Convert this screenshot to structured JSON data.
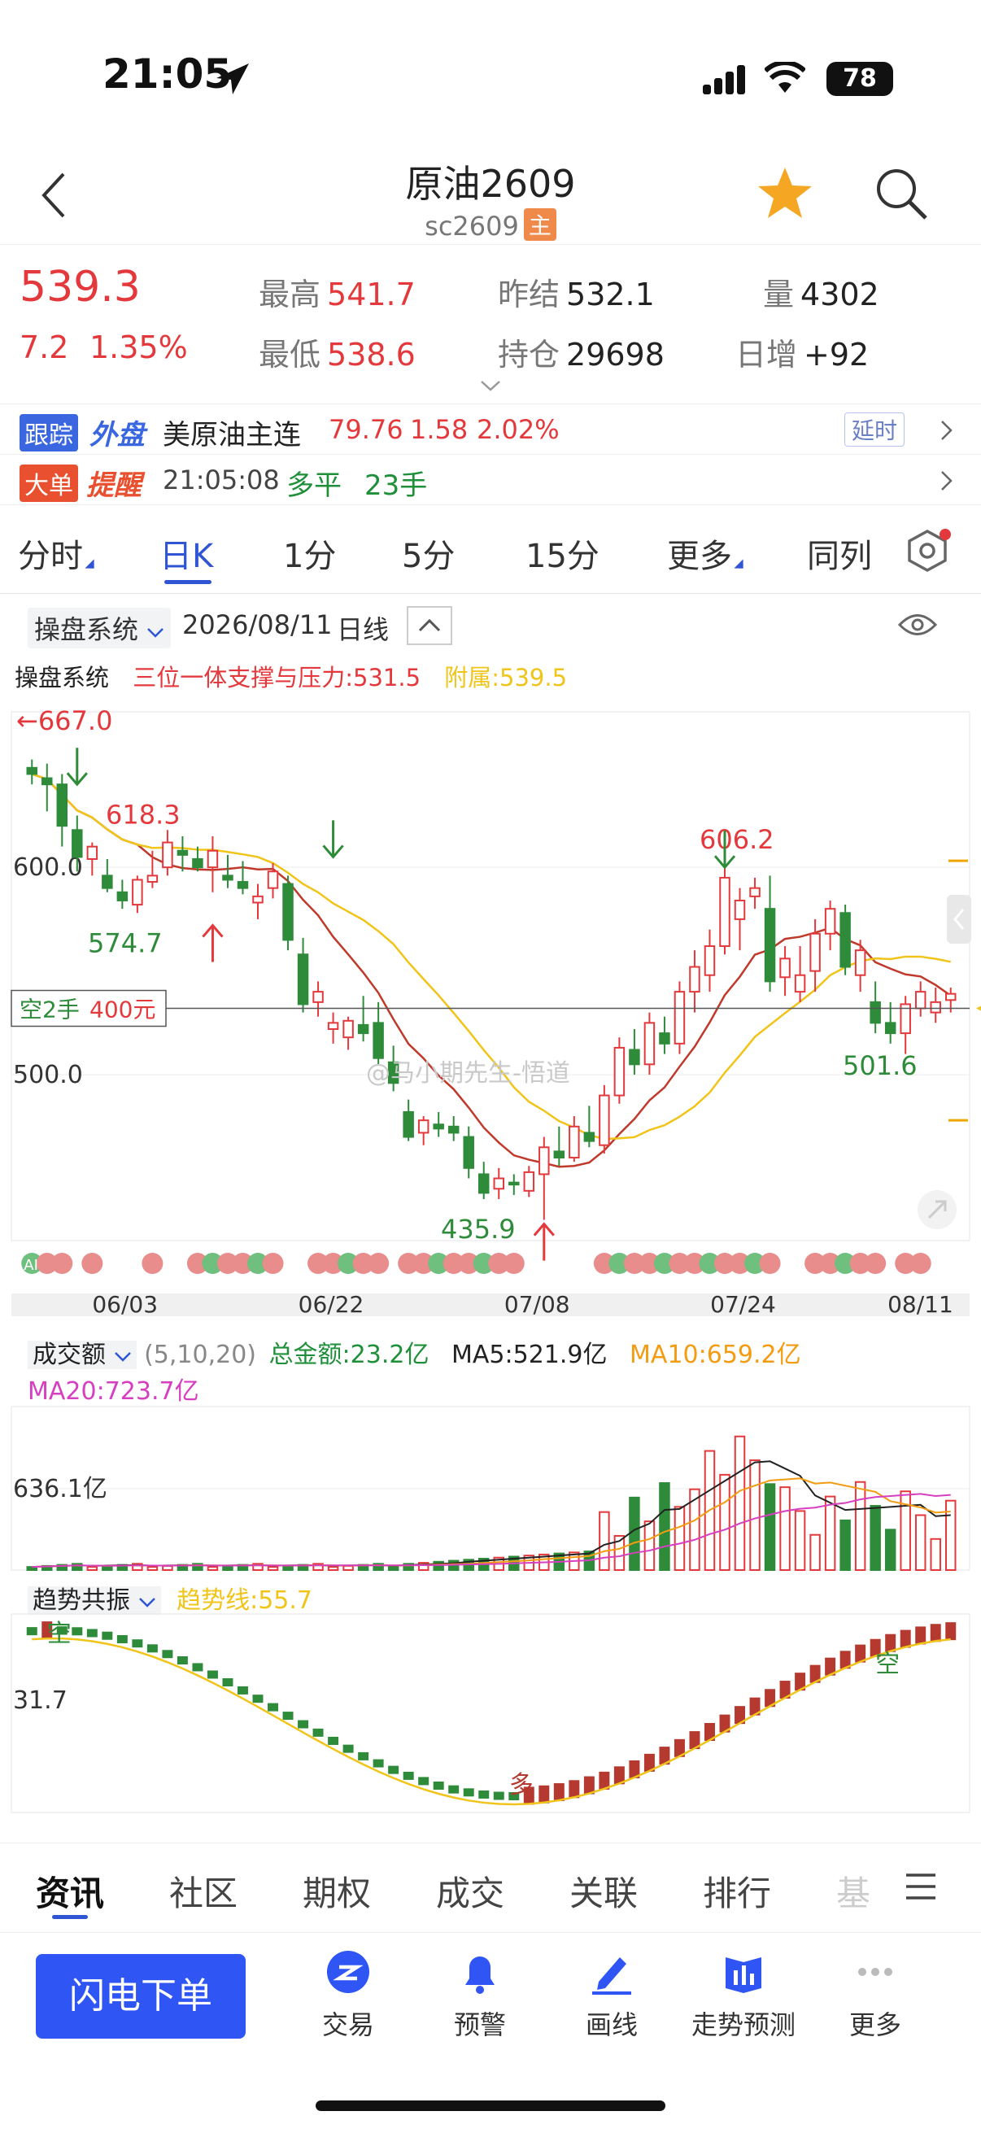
{
  "status": {
    "time": "21:05",
    "battery": "78"
  },
  "header": {
    "title": "原油2609",
    "code": "sc2609",
    "main_badge": "主"
  },
  "quote": {
    "price": "539.3",
    "change": "7.2",
    "change_pct": "1.35%",
    "high_label": "最高",
    "high": "541.7",
    "low_label": "最低",
    "low": "538.6",
    "prev_settle_label": "昨结",
    "prev_settle": "532.1",
    "open_int_label": "持仓",
    "open_int": "29698",
    "volume_label": "量",
    "volume": "4302",
    "daily_inc_label": "日增",
    "daily_inc": "+92"
  },
  "ticker": {
    "badge_a": "跟踪",
    "badge_b": "外盘",
    "name": "美原油主连",
    "price": "79.76",
    "change": "1.58",
    "pct": "2.02%",
    "delay": "延时"
  },
  "bigorder": {
    "badge_a": "大单",
    "badge_b": "提醒",
    "time": "21:05:08",
    "action": "多平",
    "qty": "23手"
  },
  "tabs": [
    {
      "label": "分时",
      "tri": true
    },
    {
      "label": "日K",
      "active": true
    },
    {
      "label": "1分"
    },
    {
      "label": "5分"
    },
    {
      "label": "15分"
    },
    {
      "label": "更多",
      "tri": true
    },
    {
      "label": "同列"
    }
  ],
  "toolbar": {
    "system": "操盘系统",
    "date": "2026/08/11",
    "period": "日线"
  },
  "indicator": {
    "name": "操盘系统",
    "support": "三位一体支撑与压力:531.5",
    "attach": "附属:539.5"
  },
  "chart_data": [
    {
      "type": "candlestick",
      "title": "日K",
      "x_ticks": [
        "06/03",
        "06/22",
        "07/08",
        "07/24",
        "08/11"
      ],
      "y_ticks": [
        "600.0",
        "500.0"
      ],
      "ylim": [
        420,
        675
      ],
      "annotations": [
        "667.0",
        "618.3",
        "574.7",
        "435.9",
        "606.2",
        "501.6"
      ],
      "position_label": "空2手",
      "position_value": "400元",
      "watermark": "@马小期先生-悟道",
      "ohlc": [
        [
          648,
          652,
          640,
          645
        ],
        [
          643,
          650,
          627,
          640
        ],
        [
          640,
          645,
          610,
          620
        ],
        [
          618,
          625,
          598,
          605
        ],
        [
          604,
          612,
          596,
          610
        ],
        [
          596,
          604,
          588,
          590
        ],
        [
          588,
          594,
          580,
          584
        ],
        [
          582,
          596,
          578,
          594
        ],
        [
          593,
          608,
          590,
          596
        ],
        [
          600,
          618,
          596,
          612
        ],
        [
          608,
          615,
          598,
          606
        ],
        [
          604,
          610,
          598,
          600
        ],
        [
          600,
          615,
          588,
          608
        ],
        [
          596,
          606,
          590,
          594
        ],
        [
          593,
          603,
          587,
          590
        ],
        [
          583,
          592,
          575,
          586
        ],
        [
          590,
          602,
          585,
          598
        ],
        [
          592,
          596,
          560,
          565
        ],
        [
          558,
          566,
          530,
          534
        ],
        [
          535,
          545,
          528,
          540
        ],
        [
          522,
          530,
          515,
          525
        ],
        [
          518,
          528,
          512,
          526
        ],
        [
          524,
          538,
          516,
          520
        ],
        [
          525,
          535,
          505,
          508
        ],
        [
          506,
          514,
          492,
          496
        ],
        [
          482,
          488,
          468,
          470
        ],
        [
          472,
          480,
          466,
          478
        ],
        [
          476,
          482,
          470,
          474
        ],
        [
          475,
          480,
          468,
          472
        ],
        [
          470,
          475,
          450,
          455
        ],
        [
          452,
          458,
          440,
          443
        ],
        [
          445,
          455,
          440,
          450
        ],
        [
          448,
          452,
          442,
          447
        ],
        [
          444,
          456,
          441,
          453
        ],
        [
          452,
          470,
          430,
          465
        ],
        [
          463,
          475,
          456,
          460
        ],
        [
          460,
          480,
          458,
          475
        ],
        [
          472,
          485,
          465,
          468
        ],
        [
          466,
          495,
          462,
          490
        ],
        [
          490,
          518,
          486,
          513
        ],
        [
          512,
          522,
          500,
          505
        ],
        [
          505,
          530,
          500,
          525
        ],
        [
          520,
          528,
          510,
          515
        ],
        [
          515,
          545,
          510,
          540
        ],
        [
          540,
          560,
          530,
          552
        ],
        [
          548,
          570,
          540,
          562
        ],
        [
          562,
          600,
          558,
          595
        ],
        [
          575,
          590,
          560,
          584
        ],
        [
          586,
          595,
          580,
          590
        ],
        [
          580,
          596,
          540,
          545
        ],
        [
          547,
          562,
          538,
          556
        ],
        [
          540,
          562,
          535,
          548
        ],
        [
          550,
          575,
          540,
          568
        ],
        [
          568,
          584,
          560,
          580
        ],
        [
          578,
          582,
          548,
          552
        ],
        [
          548,
          565,
          540,
          560
        ],
        [
          535,
          545,
          520,
          525
        ],
        [
          525,
          535,
          515,
          520
        ],
        [
          520,
          538,
          510,
          534
        ],
        [
          532,
          545,
          528,
          540
        ],
        [
          530,
          542,
          525,
          535
        ],
        [
          536,
          542,
          530,
          539
        ]
      ]
    },
    {
      "type": "bar",
      "title": "成交额",
      "params": "(5,10,20)",
      "total": "总金额:23.2亿",
      "series": [
        {
          "name": "MA5",
          "label": "MA5:521.9亿"
        },
        {
          "name": "MA10",
          "label": "MA10:659.2亿"
        },
        {
          "name": "MA20",
          "label": "MA20:723.7亿"
        }
      ],
      "y_tick": "636.1亿"
    },
    {
      "type": "line",
      "title": "趋势共振",
      "trend_label": "趋势线:55.7",
      "y_tick": "31.7",
      "markers": [
        "空",
        "多",
        "空"
      ]
    }
  ],
  "bottom_tabs": [
    "资讯",
    "社区",
    "期权",
    "成交",
    "关联",
    "排行",
    "基"
  ],
  "footer": {
    "order_button": "闪电下单",
    "items": [
      {
        "label": "交易",
        "icon": "trade-icon"
      },
      {
        "label": "预警",
        "icon": "bell-icon"
      },
      {
        "label": "画线",
        "icon": "pen-icon"
      },
      {
        "label": "走势预测",
        "icon": "forecast-icon"
      },
      {
        "label": "更多",
        "icon": "more-dots-icon"
      }
    ]
  },
  "colors": {
    "up": "#e4393c",
    "down": "#2e8b3a",
    "accent": "#2f55d4",
    "ma_red": "#c0392b",
    "ma_yellow": "#f0c419"
  }
}
